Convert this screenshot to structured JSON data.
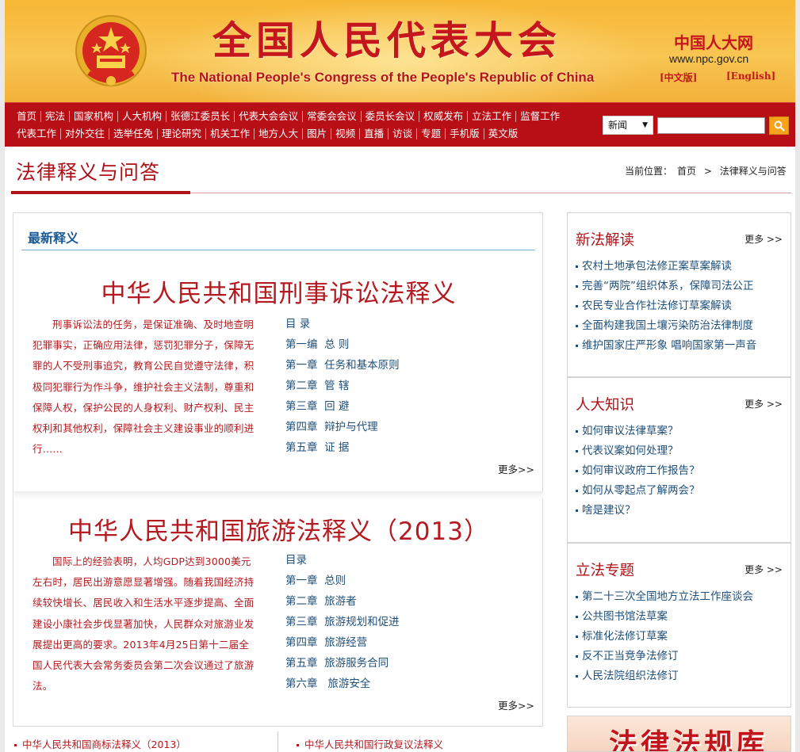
{
  "header": {
    "site_title": "全国人民代表大会",
    "site_subtitle": "The National People's Congress of the People's Republic of China",
    "logo_text": "中国人大网",
    "url_text": "www.npc.gov.cn",
    "lang_zh": "[中文版]",
    "lang_en": "[English]"
  },
  "nav": {
    "row1": [
      "首页",
      "宪法",
      "国家机构",
      "人大机构",
      "张德江委员长",
      "代表大会会议",
      "常委会会议",
      "委员长会议",
      "权威发布",
      "立法工作",
      "监督工作"
    ],
    "row2": [
      "代表工作",
      "对外交往",
      "选举任免",
      "理论研究",
      "机关工作",
      "地方人大",
      "图片",
      "视频",
      "直播",
      "访谈",
      "专题",
      "手机版",
      "英文版"
    ],
    "search_select": "新闻",
    "search_placeholder": ""
  },
  "page": {
    "title": "法律释义与问答",
    "breadcrumb_prefix": "当前位置：",
    "breadcrumb_home": "首页",
    "breadcrumb_sep": ">",
    "breadcrumb_current": "法律释义与问答"
  },
  "main": {
    "section_title": "最新释义",
    "laws": [
      {
        "title": "中华人民共和国刑事诉讼法释义",
        "intro": "刑事诉讼法的任务，是保证准确、及时地查明犯罪事实，正确应用法律，惩罚犯罪分子，保障无罪的人不受刑事追究，教育公民自觉遵守法律，积极同犯罪行为作斗争，维护社会主义法制，尊重和保障人权，保护公民的人身权利、财产权利、民主权利和其他权利，保障社会主义建设事业的顺利进行……",
        "toc": [
          "目 录",
          "第一编  总 则",
          "第一章  任务和基本原则",
          "第二章  管 辖",
          "第三章  回 避",
          "第四章  辩护与代理",
          "第五章  证 据"
        ],
        "more": "更多>>"
      },
      {
        "title": "中华人民共和国旅游法释义（2013）",
        "intro": "国际上的经验表明，人均GDP达到3000美元左右时，居民出游意愿显著增强。随着我国经济持续较快增长、居民收入和生活水平逐步提高、全面建设小康社会步伐显著加快，人民群众对旅游业发展提出更高的要求。2013年4月25日第十二届全国人民代表大会常务委员会第二次会议通过了旅游法。",
        "toc": [
          "目录",
          "第一章  总则",
          "第二章  旅游者",
          "第三章  旅游规划和促进",
          "第四章  旅游经营",
          "第五章  旅游服务合同",
          "第六章   旅游安全"
        ],
        "more": "更多>>"
      }
    ],
    "bottom_links": [
      "中华人民共和国商标法释义（2013）",
      "中华人民共和国行政复议法释义"
    ]
  },
  "sidebar": {
    "boxes": [
      {
        "title": "新法解读",
        "more": "更多 >>",
        "items": [
          "农村土地承包法修正案草案解读",
          "完善“两院”组织体系，保障司法公正",
          "农民专业合作社法修订草案解读",
          "全面构建我国土壤污染防治法律制度",
          "维护国家庄严形象 唱响国家第一声音"
        ]
      },
      {
        "title": "人大知识",
        "more": "更多 >>",
        "items": [
          "如何审议法律草案？",
          "代表议案如何处理？",
          "如何审议政府工作报告？",
          "如何从零起点了解两会？",
          "啥是建议？"
        ]
      },
      {
        "title": "立法专题",
        "more": "更多 >>",
        "items": [
          "第二十三次全国地方立法工作座谈会",
          "公共图书馆法草案",
          "标准化法修订草案",
          "反不正当竞争法修订",
          "人民法院组织法修订"
        ]
      }
    ],
    "banner_text": "法律法规库"
  },
  "colors": {
    "brand_red": "#b80f16",
    "header_gold": "#f7b735",
    "link_blue": "#1e4f7a",
    "title_red": "#b41a1f"
  }
}
